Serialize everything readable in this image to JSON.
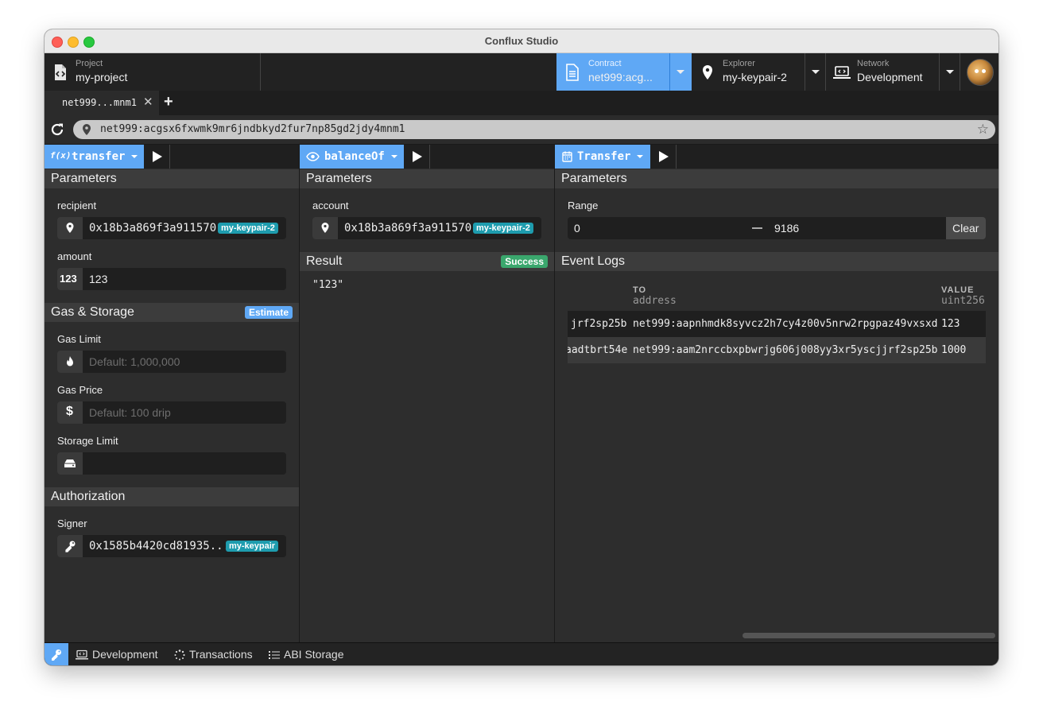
{
  "window": {
    "title": "Conflux Studio"
  },
  "header": {
    "project": {
      "label": "Project",
      "value": "my-project"
    },
    "contract": {
      "label": "Contract",
      "value": "net999:acg..."
    },
    "explorer": {
      "label": "Explorer",
      "value": "my-keypair-2"
    },
    "network": {
      "label": "Network",
      "value": "Development"
    }
  },
  "tabs": [
    {
      "label": "net999...mnm1",
      "close": "✕"
    }
  ],
  "tab_add": "+",
  "address_bar": {
    "url": "net999:acgsx6fxwmk9mr6jndbkyd2fur7np85gd2jdy4mnm1"
  },
  "panel1": {
    "method": "transfer",
    "method_icon": "f(x)",
    "parameters_title": "Parameters",
    "recipient": {
      "label": "recipient",
      "value": "0x18b3a869f3a911570",
      "chip": "my-keypair-2"
    },
    "amount": {
      "label": "amount",
      "icon": "123",
      "value": "123"
    },
    "gas_storage_title": "Gas & Storage",
    "estimate_label": "Estimate",
    "gas_limit": {
      "label": "Gas Limit",
      "placeholder": "Default: 1,000,000"
    },
    "gas_price": {
      "label": "Gas Price",
      "placeholder": "Default: 100 drip"
    },
    "storage_limit": {
      "label": "Storage Limit",
      "placeholder": ""
    },
    "authorization_title": "Authorization",
    "signer": {
      "label": "Signer",
      "value": "0x1585b4420cd81935...",
      "chip": "my-keypair"
    }
  },
  "panel2": {
    "method": "balanceOf",
    "parameters_title": "Parameters",
    "account": {
      "label": "account",
      "value": "0x18b3a869f3a911570",
      "chip": "my-keypair-2"
    },
    "result_title": "Result",
    "result_status": "Success",
    "result_value": "\"123\""
  },
  "panel3": {
    "event": "Transfer",
    "parameters_title": "Parameters",
    "range": {
      "label": "Range",
      "from": "0",
      "to": "9186",
      "clear_label": "Clear"
    },
    "event_logs_title": "Event Logs",
    "columns": [
      {
        "name": "TO",
        "type": "address"
      },
      {
        "name": "VALUE",
        "type": "uint256"
      }
    ],
    "rows": [
      {
        "from_tail": "jrf2sp25b",
        "to": "net999:aapnhmdk8syvcz2h7cy4z00v5nrw2rpgpaz49vxsxd",
        "value": "123"
      },
      {
        "from_tail": "aadtbrt54e",
        "to": "net999:aam2nrccbxpbwrjg606j008yy3xr5yscjjrf2sp25b",
        "value": "1000"
      }
    ]
  },
  "statusbar": {
    "network_label": "Development",
    "transactions_label": "Transactions",
    "abi_label": "ABI Storage"
  },
  "colors": {
    "accent": "#5fa8f5",
    "success": "#3aa76d",
    "chip": "#1e9cae",
    "panel_bg": "#2d2d2d"
  }
}
